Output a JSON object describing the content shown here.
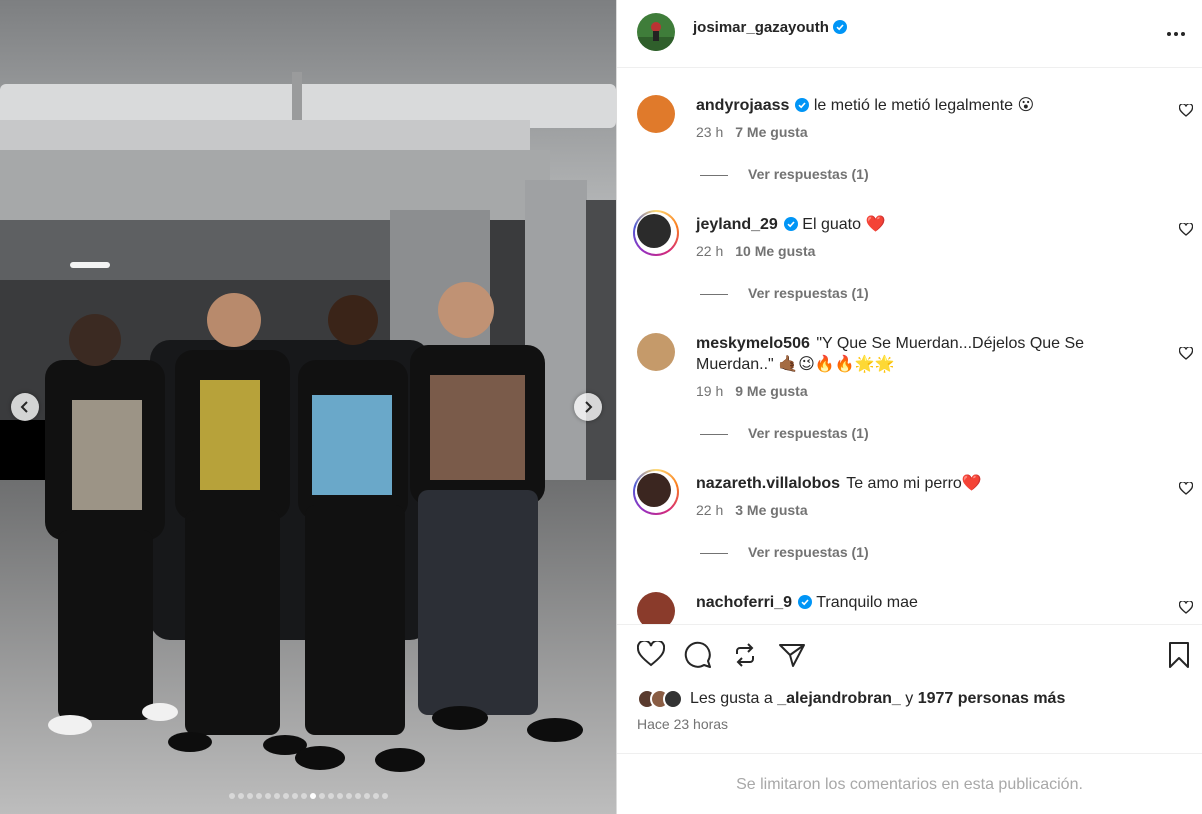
{
  "post": {
    "author": "josimar_gazayouth",
    "carousel": {
      "total_slides": 12,
      "active_slide": 6
    }
  },
  "comments": [
    {
      "user": "andyrojaass",
      "verified": true,
      "text": "le metió le metió legalmente 😮",
      "time": "23 h",
      "likes": "7 Me gusta",
      "replies": "Ver respuestas (1)",
      "ring": false
    },
    {
      "user": "jeyland_29",
      "verified": true,
      "text": "El guato ❤️",
      "time": "22 h",
      "likes": "10 Me gusta",
      "replies": "Ver respuestas (1)",
      "ring": true
    },
    {
      "user": "meskymelo506",
      "verified": false,
      "text": "\"Y Que Se Muerdan...Déjelos Que Se Muerdan..\" 🤙🏾😉🔥🔥🌟🌟",
      "time": "19 h",
      "likes": "9 Me gusta",
      "replies": "Ver respuestas (1)",
      "ring": false
    },
    {
      "user": "nazareth.villalobos",
      "verified": false,
      "text": "Te amo mi perro❤️",
      "time": "22 h",
      "likes": "3 Me gusta",
      "replies": "Ver respuestas (1)",
      "ring": true
    },
    {
      "user": "nachoferri_9",
      "verified": true,
      "text": "Tranquilo mae",
      "time": "",
      "likes": "",
      "replies": "",
      "ring": false
    }
  ],
  "likes": {
    "prefix": "Les gusta a",
    "first_user": "_alejandrobran_",
    "connector": "y",
    "others": "1977 personas más"
  },
  "time_ago": "Hace 23 horas",
  "comments_limited": "Se limitaron los comentarios en esta publicación.",
  "colors": {
    "verified": "#0095f6",
    "text": "#262626",
    "muted": "#737373"
  },
  "icons": [
    "chevron-left-icon",
    "chevron-right-icon",
    "more-icon",
    "heart-icon",
    "comment-icon",
    "repost-icon",
    "share-icon",
    "bookmark-icon",
    "verified-icon"
  ]
}
